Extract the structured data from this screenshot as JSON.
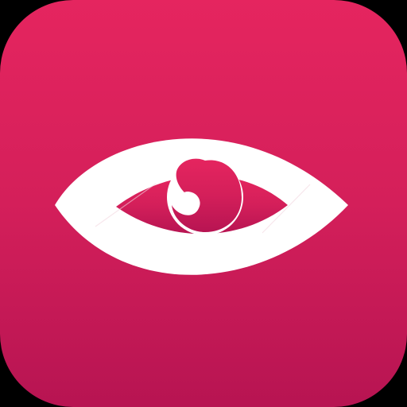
{
  "app_icon": {
    "icon": "eye-icon",
    "colors": {
      "gradient_top": "#E5255F",
      "gradient_mid": "#D41F5A",
      "gradient_bottom": "#B71452",
      "glyph": "#FFFFFF",
      "background": "#000000"
    }
  }
}
